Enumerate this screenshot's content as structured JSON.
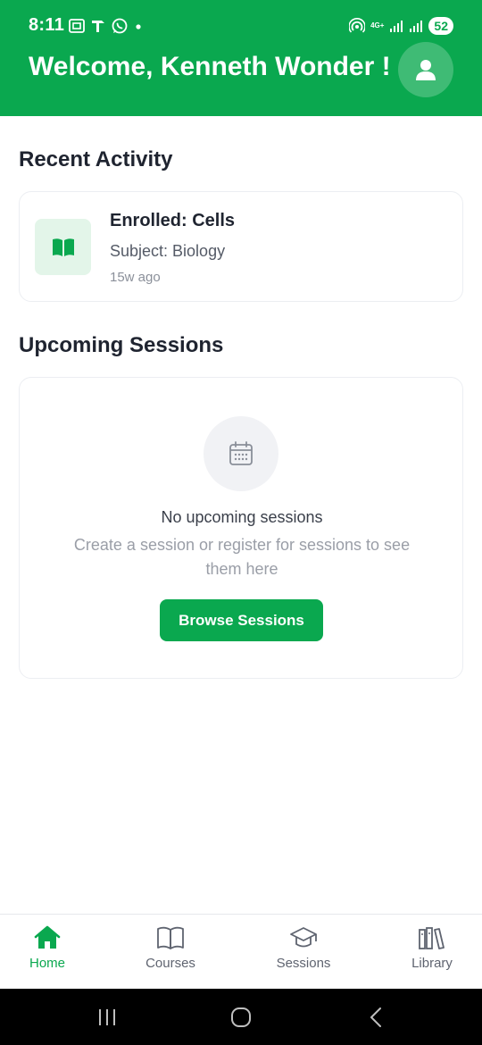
{
  "status_bar": {
    "time": "8:11",
    "network": "4G+",
    "battery": "52"
  },
  "header": {
    "welcome": "Welcome, Kenneth Wonder !",
    "avatar_icon": "user-icon",
    "background": "#0aa84f"
  },
  "recent_activity": {
    "title": "Recent Activity",
    "items": [
      {
        "icon": "book-open-icon",
        "title": "Enrolled: Cells",
        "subject": "Subject: Biology",
        "time": "15w ago"
      }
    ]
  },
  "upcoming_sessions": {
    "title": "Upcoming Sessions",
    "empty_icon": "calendar-icon",
    "empty_title": "No upcoming sessions",
    "empty_description": "Create a session or register for sessions to see them here",
    "browse_button": "Browse Sessions"
  },
  "bottom_nav": {
    "items": [
      {
        "label": "Home",
        "icon": "home-icon",
        "active": true
      },
      {
        "label": "Courses",
        "icon": "book-icon",
        "active": false
      },
      {
        "label": "Sessions",
        "icon": "graduation-cap-icon",
        "active": false
      },
      {
        "label": "Library",
        "icon": "library-icon",
        "active": false
      }
    ]
  },
  "colors": {
    "accent": "#0aa84f",
    "accent_light": "#e3f5e9",
    "text_primary": "#1f2430",
    "text_muted": "#9a9ea7"
  }
}
